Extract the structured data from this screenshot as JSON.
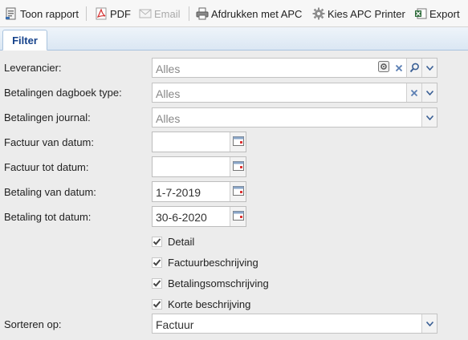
{
  "toolbar": {
    "buttons": [
      {
        "label": "Toon rapport",
        "icon": "report-icon"
      },
      {
        "label": "PDF",
        "icon": "pdf-icon"
      },
      {
        "label": "Email",
        "icon": "email-icon",
        "disabled": true
      },
      {
        "label": "Afdrukken met APC",
        "icon": "printer-icon"
      },
      {
        "label": "Kies APC Printer",
        "icon": "gear-icon"
      },
      {
        "label": "Export",
        "icon": "excel-icon"
      }
    ]
  },
  "tabs": [
    {
      "label": "Filter",
      "active": true
    }
  ],
  "form": {
    "supplier": {
      "label": "Leverancier:",
      "value": "Alles"
    },
    "journal_type": {
      "label": "Betalingen dagboek type:",
      "value": "Alles"
    },
    "journal": {
      "label": "Betalingen journal:",
      "value": "Alles"
    },
    "invoice_from": {
      "label": "Factuur van datum:",
      "value": ""
    },
    "invoice_to": {
      "label": "Factuur tot datum:",
      "value": ""
    },
    "payment_from": {
      "label": "Betaling van datum:",
      "value": "1-7-2019"
    },
    "payment_to": {
      "label": "Betaling tot datum:",
      "value": "30-6-2020"
    },
    "checkboxes": [
      {
        "label": "Detail",
        "checked": true
      },
      {
        "label": "Factuurbeschrijving",
        "checked": true
      },
      {
        "label": "Betalingsomschrijving",
        "checked": true
      },
      {
        "label": "Korte beschrijving",
        "checked": true
      }
    ],
    "sort": {
      "label": "Sorteren op:",
      "value": "Factuur"
    }
  },
  "colors": {
    "accent": "#15428b",
    "clear_x": "#5b7fb3",
    "tab_border": "#a9c3de"
  }
}
